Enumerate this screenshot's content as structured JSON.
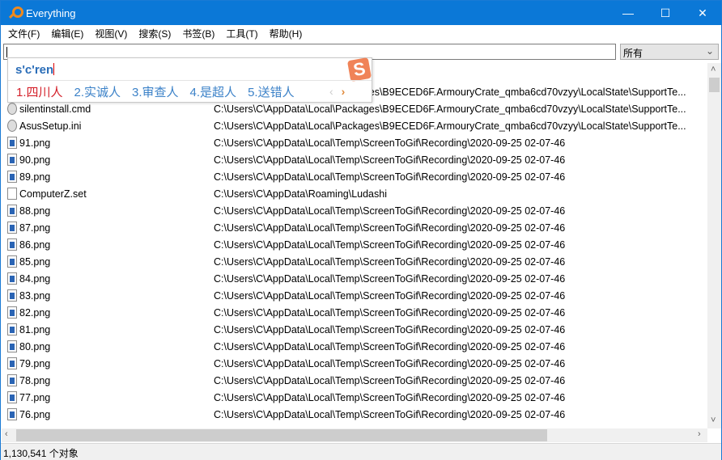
{
  "window": {
    "title": "Everything",
    "minimize": "—",
    "maximize": "☐",
    "close": "✕"
  },
  "menu": [
    "文件(F)",
    "编辑(E)",
    "视图(V)",
    "搜索(S)",
    "书签(B)",
    "工具(T)",
    "帮助(H)"
  ],
  "search": {
    "value": "",
    "filter": "所有"
  },
  "ime": {
    "pinyin": "s'c'ren",
    "candidates": [
      "1.四川人",
      "2.实诚人",
      "3.审查人",
      "4.是超人",
      "5.送错人"
    ],
    "prev": "‹",
    "next": "›",
    "logo": "S"
  },
  "rows": [
    {
      "name": "",
      "path": "C:\\Users\\C\\AppData\\Local\\Packages\\B9ECED6F.ArmouryCrate_qmba6cd70vzyy\\LocalState\\SupportTe...",
      "icon": "file"
    },
    {
      "name": "silentinstall.cmd",
      "path": "C:\\Users\\C\\AppData\\Local\\Packages\\B9ECED6F.ArmouryCrate_qmba6cd70vzyy\\LocalState\\SupportTe...",
      "icon": "gear"
    },
    {
      "name": "AsusSetup.ini",
      "path": "C:\\Users\\C\\AppData\\Local\\Packages\\B9ECED6F.ArmouryCrate_qmba6cd70vzyy\\LocalState\\SupportTe...",
      "icon": "gear"
    },
    {
      "name": "91.png",
      "path": "C:\\Users\\C\\AppData\\Local\\Temp\\ScreenToGif\\Recording\\2020-09-25 02-07-46",
      "icon": "png"
    },
    {
      "name": "90.png",
      "path": "C:\\Users\\C\\AppData\\Local\\Temp\\ScreenToGif\\Recording\\2020-09-25 02-07-46",
      "icon": "png"
    },
    {
      "name": "89.png",
      "path": "C:\\Users\\C\\AppData\\Local\\Temp\\ScreenToGif\\Recording\\2020-09-25 02-07-46",
      "icon": "png"
    },
    {
      "name": "ComputerZ.set",
      "path": "C:\\Users\\C\\AppData\\Roaming\\Ludashi",
      "icon": "file"
    },
    {
      "name": "88.png",
      "path": "C:\\Users\\C\\AppData\\Local\\Temp\\ScreenToGif\\Recording\\2020-09-25 02-07-46",
      "icon": "png"
    },
    {
      "name": "87.png",
      "path": "C:\\Users\\C\\AppData\\Local\\Temp\\ScreenToGif\\Recording\\2020-09-25 02-07-46",
      "icon": "png"
    },
    {
      "name": "86.png",
      "path": "C:\\Users\\C\\AppData\\Local\\Temp\\ScreenToGif\\Recording\\2020-09-25 02-07-46",
      "icon": "png"
    },
    {
      "name": "85.png",
      "path": "C:\\Users\\C\\AppData\\Local\\Temp\\ScreenToGif\\Recording\\2020-09-25 02-07-46",
      "icon": "png"
    },
    {
      "name": "84.png",
      "path": "C:\\Users\\C\\AppData\\Local\\Temp\\ScreenToGif\\Recording\\2020-09-25 02-07-46",
      "icon": "png"
    },
    {
      "name": "83.png",
      "path": "C:\\Users\\C\\AppData\\Local\\Temp\\ScreenToGif\\Recording\\2020-09-25 02-07-46",
      "icon": "png"
    },
    {
      "name": "82.png",
      "path": "C:\\Users\\C\\AppData\\Local\\Temp\\ScreenToGif\\Recording\\2020-09-25 02-07-46",
      "icon": "png"
    },
    {
      "name": "81.png",
      "path": "C:\\Users\\C\\AppData\\Local\\Temp\\ScreenToGif\\Recording\\2020-09-25 02-07-46",
      "icon": "png"
    },
    {
      "name": "80.png",
      "path": "C:\\Users\\C\\AppData\\Local\\Temp\\ScreenToGif\\Recording\\2020-09-25 02-07-46",
      "icon": "png"
    },
    {
      "name": "79.png",
      "path": "C:\\Users\\C\\AppData\\Local\\Temp\\ScreenToGif\\Recording\\2020-09-25 02-07-46",
      "icon": "png"
    },
    {
      "name": "78.png",
      "path": "C:\\Users\\C\\AppData\\Local\\Temp\\ScreenToGif\\Recording\\2020-09-25 02-07-46",
      "icon": "png"
    },
    {
      "name": "77.png",
      "path": "C:\\Users\\C\\AppData\\Local\\Temp\\ScreenToGif\\Recording\\2020-09-25 02-07-46",
      "icon": "png"
    },
    {
      "name": "76.png",
      "path": "C:\\Users\\C\\AppData\\Local\\Temp\\ScreenToGif\\Recording\\2020-09-25 02-07-46",
      "icon": "png"
    }
  ],
  "status": "1,130,541 个对象",
  "colors": {
    "titlebar": "#0b78d7",
    "ime_selected": "#d4202a",
    "ime_candidate": "#3c82c8"
  }
}
